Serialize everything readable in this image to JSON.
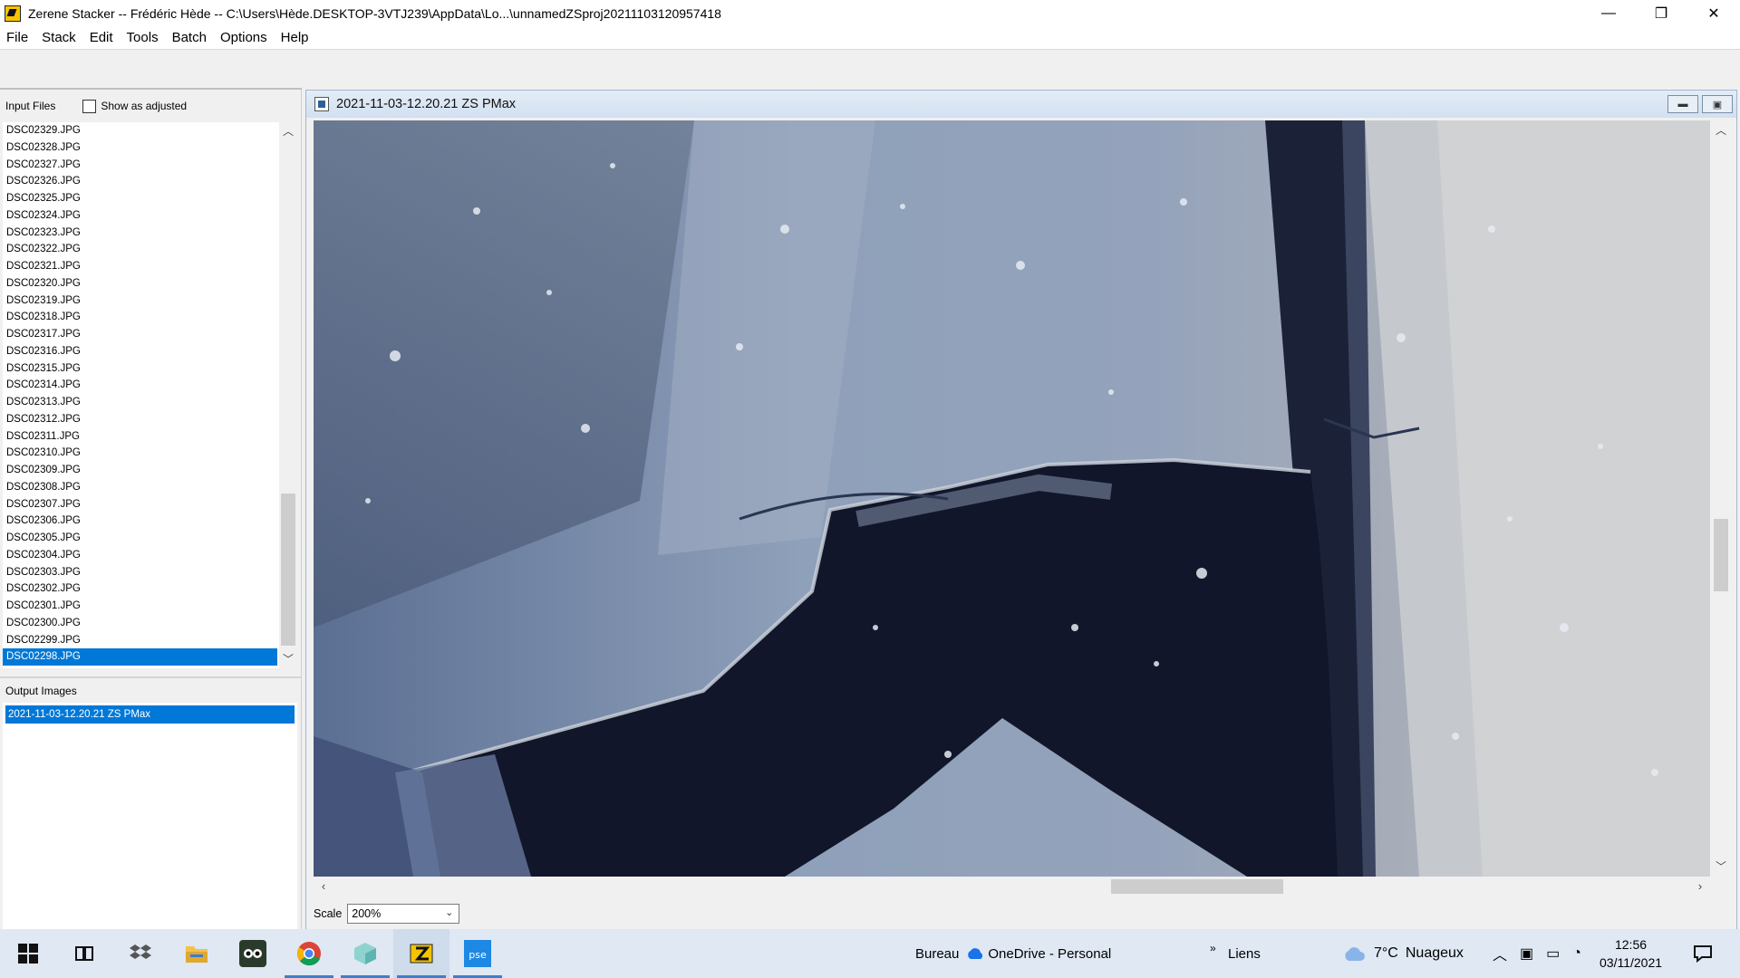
{
  "window": {
    "title": "Zerene Stacker -- Frédéric Hède -- C:\\Users\\Hède.DESKTOP-3VTJ239\\AppData\\Lo...\\unnamedZSproj20211103120957418",
    "minimize": "—",
    "maximize": "❐",
    "close": "✕"
  },
  "menu": [
    "File",
    "Stack",
    "Edit",
    "Tools",
    "Batch",
    "Options",
    "Help"
  ],
  "left_panel": {
    "input_files_label": "Input Files",
    "show_adjusted_label": "Show as adjusted",
    "files": [
      "DSC02329.JPG",
      "DSC02328.JPG",
      "DSC02327.JPG",
      "DSC02326.JPG",
      "DSC02325.JPG",
      "DSC02324.JPG",
      "DSC02323.JPG",
      "DSC02322.JPG",
      "DSC02321.JPG",
      "DSC02320.JPG",
      "DSC02319.JPG",
      "DSC02318.JPG",
      "DSC02317.JPG",
      "DSC02316.JPG",
      "DSC02315.JPG",
      "DSC02314.JPG",
      "DSC02313.JPG",
      "DSC02312.JPG",
      "DSC02311.JPG",
      "DSC02310.JPG",
      "DSC02309.JPG",
      "DSC02308.JPG",
      "DSC02307.JPG",
      "DSC02306.JPG",
      "DSC02305.JPG",
      "DSC02304.JPG",
      "DSC02303.JPG",
      "DSC02302.JPG",
      "DSC02301.JPG",
      "DSC02300.JPG",
      "DSC02299.JPG",
      "DSC02298.JPG"
    ],
    "selected_file": "DSC02298.JPG",
    "output_images_label": "Output Images",
    "output_images": [
      "2021-11-03-12.20.21 ZS PMax"
    ]
  },
  "image_window": {
    "title": "2021-11-03-12.20.21 ZS PMax",
    "scale_label": "Scale",
    "scale_value": "200%"
  },
  "taskbar": {
    "toolbar_bureau": "Bureau",
    "onedrive": "OneDrive - Personal",
    "liens": "Liens",
    "weather_temp": "7°C",
    "weather_desc": "Nuageux",
    "time": "12:56",
    "date": "03/11/2021",
    "icons": [
      "windows-start-icon",
      "task-view-icon",
      "dropbox-icon",
      "file-explorer-icon",
      "tripadvisor-icon",
      "chrome-icon",
      "app-cube-icon",
      "zerene-stacker-icon",
      "photoshop-elements-icon"
    ]
  },
  "colors": {
    "selection": "#0078d7",
    "taskbar": "#dfe8f3"
  }
}
